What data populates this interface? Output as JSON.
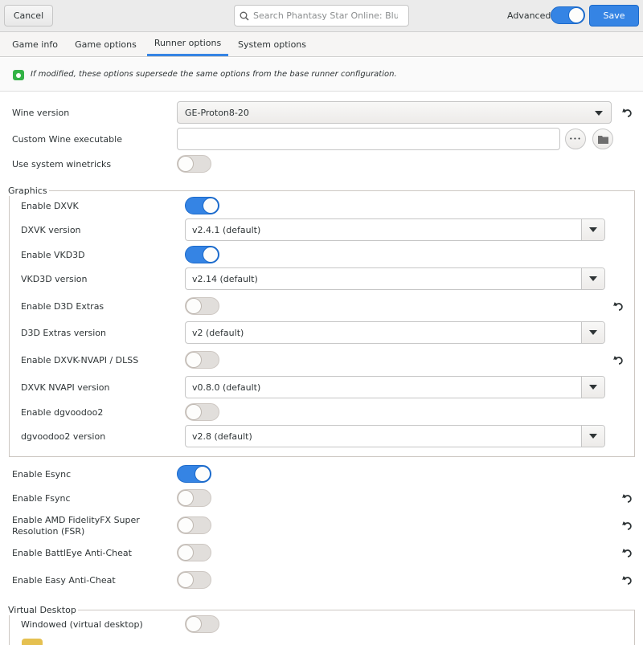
{
  "header": {
    "cancel_label": "Cancel",
    "search_placeholder": "Search Phantasy Star Online: Blue ...",
    "advanced_label": "Advanced",
    "advanced_on": true,
    "save_label": "Save",
    "accent_color": "#3584e4"
  },
  "tabs": [
    {
      "label": "Game info",
      "active": false
    },
    {
      "label": "Game options",
      "active": false
    },
    {
      "label": "Runner options",
      "active": true
    },
    {
      "label": "System options",
      "active": false
    }
  ],
  "info": {
    "text": "If modified, these options supersede the same options from the base runner configuration.",
    "icon": "info-icon"
  },
  "wine": {
    "version_label": "Wine version",
    "version_value": "GE-Proton8-20",
    "custom_exe_label": "Custom Wine executable",
    "custom_exe_value": "",
    "more_glyph": "•••",
    "winetricks_label": "Use system winetricks",
    "winetricks_on": false
  },
  "graphics": {
    "title": "Graphics",
    "enable_dxvk_label": "Enable DXVK",
    "enable_dxvk_on": true,
    "dxvk_version_label": "DXVK version",
    "dxvk_version_value": "v2.4.1 (default)",
    "enable_vkd3d_label": "Enable VKD3D",
    "enable_vkd3d_on": true,
    "vkd3d_version_label": "VKD3D version",
    "vkd3d_version_value": "v2.14 (default)",
    "enable_d3d_extras_label": "Enable D3D Extras",
    "enable_d3d_extras_on": false,
    "d3d_extras_version_label": "D3D Extras version",
    "d3d_extras_version_value": "v2 (default)",
    "enable_nvapi_label": "Enable DXVK-NVAPI / DLSS",
    "enable_nvapi_on": false,
    "nvapi_version_label": "DXVK NVAPI version",
    "nvapi_version_value": "v0.8.0 (default)",
    "enable_dgvoodoo2_label": "Enable dgvoodoo2",
    "enable_dgvoodoo2_on": false,
    "dgvoodoo2_version_label": "dgvoodoo2 version",
    "dgvoodoo2_version_value": "v2.8 (default)"
  },
  "sync": {
    "esync_label": "Enable Esync",
    "esync_on": true,
    "fsync_label": "Enable Fsync",
    "fsync_on": false,
    "fsr_label_line1": "Enable AMD FidelityFX Super",
    "fsr_label_line2": "Resolution (FSR)",
    "fsr_on": false,
    "battleye_label": "Enable BattlEye Anti-Cheat",
    "battleye_on": false,
    "eac_label": "Enable Easy Anti-Cheat",
    "eac_on": false
  },
  "virtual_desktop": {
    "title": "Virtual Desktop",
    "windowed_label": "Windowed (virtual desktop)",
    "windowed_on": false
  }
}
